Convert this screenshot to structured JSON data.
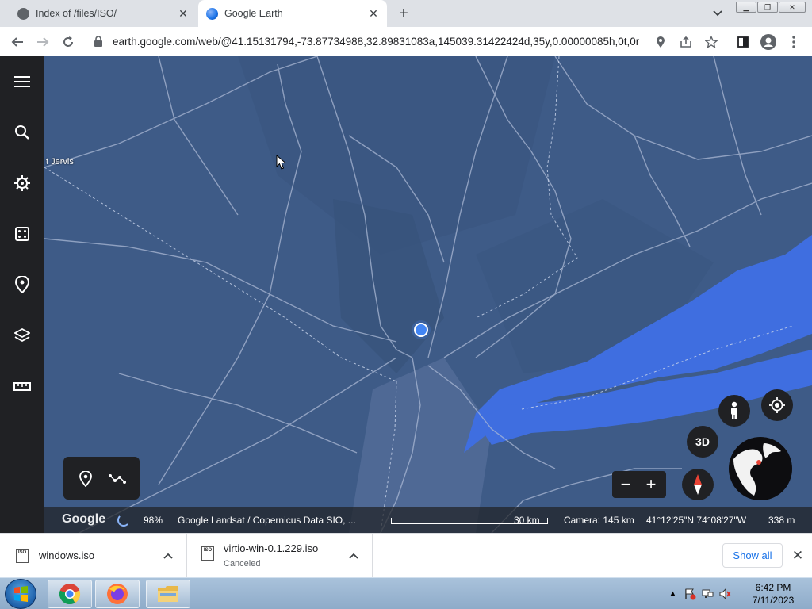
{
  "browser": {
    "tabs": [
      {
        "title": "Index of /files/ISO/",
        "active": false,
        "icon": "page-favicon-icon"
      },
      {
        "title": "Google Earth",
        "active": true,
        "icon": "earth-favicon-icon"
      }
    ],
    "new_tab_label": "+",
    "tab_search_icon": "chevron-down-icon",
    "window_controls": [
      "minimize-icon",
      "restore-icon",
      "close-icon"
    ],
    "url": "earth.google.com/web/@41.15131794,-73.87734988,32.89831083a,145039.31422424d,35y,0.00000085h,0t,0r",
    "toolbar_icons": [
      "back-arrow-icon",
      "forward-arrow-icon",
      "reload-icon",
      "lock-icon",
      "location-pin-icon",
      "share-icon",
      "star-icon",
      "side-panel-icon",
      "profile-icon",
      "more-vert-icon"
    ]
  },
  "earth": {
    "sidebar": [
      "menu-icon",
      "search-icon",
      "voyager-icon",
      "feeling-lucky-icon",
      "projects-icon",
      "map-style-icon",
      "measure-icon"
    ],
    "place_label": "t Jervis",
    "tools": [
      "add-placemark-icon",
      "draw-path-icon"
    ],
    "three_d_label": "3D",
    "zoom_out_label": "−",
    "zoom_in_label": "+",
    "status": {
      "logo": "Google",
      "progress": "98%",
      "progress_value": 0.98,
      "attribution": "Google  Landsat / Copernicus  Data SIO, ...",
      "scale": "30 km",
      "camera": "Camera: 145 km",
      "coordinates": "41°12'25\"N 74°08'27\"W",
      "elevation": "338 m"
    },
    "colors": {
      "land": "#3e5b87",
      "water": "#3f6ee0",
      "sidebar": "#202124",
      "location_dot": "#4285f4"
    }
  },
  "downloads": {
    "items": [
      {
        "name": "windows.iso",
        "status": "",
        "icon_text": "ISO"
      },
      {
        "name": "virtio-win-0.1.229.iso",
        "status": "Canceled",
        "icon_text": "ISO"
      }
    ],
    "show_all_label": "Show all",
    "close_label": "✕"
  },
  "taskbar": {
    "apps": [
      "chrome-icon",
      "firefox-icon",
      "file-explorer-icon"
    ],
    "tray_icons": [
      "show-hidden-icons-arrow",
      "action-center-flag-icon",
      "network-icon",
      "volume-muted-icon"
    ],
    "time": "6:42 PM",
    "date": "7/11/2023"
  }
}
